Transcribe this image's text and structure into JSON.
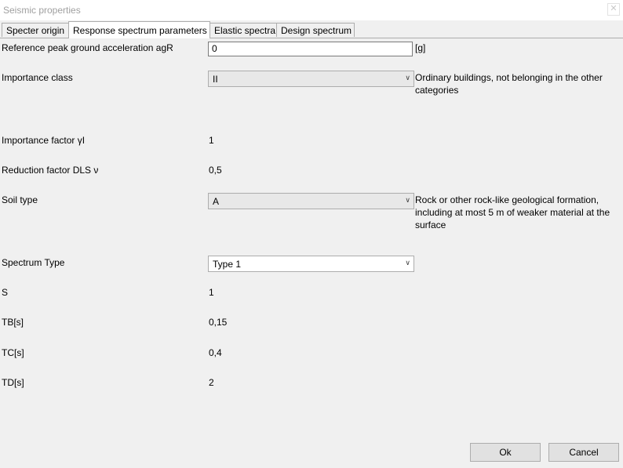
{
  "window": {
    "title": "Seismic properties",
    "close_glyph": "✕"
  },
  "tabs": [
    {
      "label": "Specter origin",
      "active": false
    },
    {
      "label": "Response spectrum parameters",
      "active": true
    },
    {
      "label": "Elastic spectra",
      "active": false
    },
    {
      "label": "Design spectrum",
      "active": false
    }
  ],
  "form": {
    "agr": {
      "label": "Reference peak ground acceleration agR",
      "value": "0",
      "unit": "[g]"
    },
    "importance_class": {
      "label": "Importance class",
      "selected": "II",
      "description": "Ordinary buildings, not belonging in the other categories"
    },
    "importance_factor": {
      "label": "Importance factor  γI",
      "value": "1"
    },
    "reduction_factor": {
      "label": "Reduction factor DLS ν",
      "value": "0,5"
    },
    "soil_type": {
      "label": "Soil type",
      "selected": "A",
      "description": "Rock or other rock-like geological formation, including at most 5 m of weaker material at the surface"
    },
    "spectrum_type": {
      "label": "Spectrum Type",
      "selected": "Type 1"
    },
    "s": {
      "label": "S",
      "value": "1"
    },
    "tb": {
      "label": "TB[s]",
      "value": "0,15"
    },
    "tc": {
      "label": "TC[s]",
      "value": "0,4"
    },
    "td": {
      "label": "TD[s]",
      "value": "2"
    }
  },
  "buttons": {
    "ok": "Ok",
    "cancel": "Cancel"
  },
  "icons": {
    "dropdown": "chevron-down-icon",
    "close": "close-icon"
  },
  "colors": {
    "background": "#f0f0f0",
    "border": "#adadad",
    "title_text": "#a0a0a0"
  }
}
